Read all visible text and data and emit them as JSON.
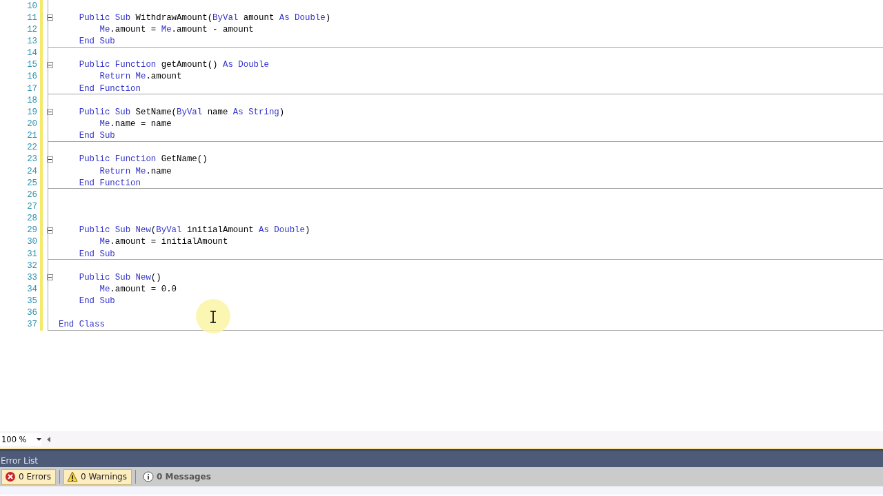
{
  "editor": {
    "lines": [
      {
        "number": "10",
        "fold": false,
        "separator_below": false
      },
      {
        "number": "11",
        "fold": true,
        "separator_below": false,
        "tokens": [
          {
            "kind": "keyword",
            "text": "    Public Sub"
          },
          {
            "kind": "plain",
            "text": " WithdrawAmount("
          },
          {
            "kind": "keyword",
            "text": "ByVal"
          },
          {
            "kind": "plain",
            "text": " amount "
          },
          {
            "kind": "keyword",
            "text": "As Double"
          },
          {
            "kind": "plain",
            "text": ")"
          }
        ]
      },
      {
        "number": "12",
        "fold": false,
        "separator_below": false,
        "tokens": [
          {
            "kind": "keyword",
            "text": "        Me"
          },
          {
            "kind": "plain",
            "text": ".amount = "
          },
          {
            "kind": "keyword",
            "text": "Me"
          },
          {
            "kind": "plain",
            "text": ".amount - amount"
          }
        ]
      },
      {
        "number": "13",
        "fold": false,
        "separator_below": true,
        "tokens": [
          {
            "kind": "keyword",
            "text": "    End Sub"
          }
        ]
      },
      {
        "number": "14",
        "fold": false,
        "separator_below": false
      },
      {
        "number": "15",
        "fold": true,
        "separator_below": false,
        "tokens": [
          {
            "kind": "keyword",
            "text": "    Public Function"
          },
          {
            "kind": "plain",
            "text": " getAmount() "
          },
          {
            "kind": "keyword",
            "text": "As Double"
          }
        ]
      },
      {
        "number": "16",
        "fold": false,
        "separator_below": false,
        "tokens": [
          {
            "kind": "keyword",
            "text": "        Return Me"
          },
          {
            "kind": "plain",
            "text": ".amount"
          }
        ]
      },
      {
        "number": "17",
        "fold": false,
        "separator_below": true,
        "tokens": [
          {
            "kind": "keyword",
            "text": "    End Function"
          }
        ]
      },
      {
        "number": "18",
        "fold": false,
        "separator_below": false
      },
      {
        "number": "19",
        "fold": true,
        "separator_below": false,
        "tokens": [
          {
            "kind": "keyword",
            "text": "    Public Sub"
          },
          {
            "kind": "plain",
            "text": " SetName("
          },
          {
            "kind": "keyword",
            "text": "ByVal"
          },
          {
            "kind": "plain",
            "text": " name "
          },
          {
            "kind": "keyword",
            "text": "As String"
          },
          {
            "kind": "plain",
            "text": ")"
          }
        ]
      },
      {
        "number": "20",
        "fold": false,
        "separator_below": false,
        "tokens": [
          {
            "kind": "keyword",
            "text": "        Me"
          },
          {
            "kind": "plain",
            "text": ".name = name"
          }
        ]
      },
      {
        "number": "21",
        "fold": false,
        "separator_below": true,
        "tokens": [
          {
            "kind": "keyword",
            "text": "    End Sub"
          }
        ]
      },
      {
        "number": "22",
        "fold": false,
        "separator_below": false
      },
      {
        "number": "23",
        "fold": true,
        "separator_below": false,
        "tokens": [
          {
            "kind": "keyword",
            "text": "    Public Function"
          },
          {
            "kind": "plain",
            "text": " GetName()"
          }
        ]
      },
      {
        "number": "24",
        "fold": false,
        "separator_below": false,
        "tokens": [
          {
            "kind": "keyword",
            "text": "        Return Me"
          },
          {
            "kind": "plain",
            "text": ".name"
          }
        ]
      },
      {
        "number": "25",
        "fold": false,
        "separator_below": true,
        "tokens": [
          {
            "kind": "keyword",
            "text": "    End Function"
          }
        ]
      },
      {
        "number": "26",
        "fold": false,
        "separator_below": false
      },
      {
        "number": "27",
        "fold": false,
        "separator_below": false
      },
      {
        "number": "28",
        "fold": false,
        "separator_below": false
      },
      {
        "number": "29",
        "fold": true,
        "separator_below": false,
        "tokens": [
          {
            "kind": "keyword",
            "text": "    Public Sub New"
          },
          {
            "kind": "plain",
            "text": "("
          },
          {
            "kind": "keyword",
            "text": "ByVal"
          },
          {
            "kind": "plain",
            "text": " initialAmount "
          },
          {
            "kind": "keyword",
            "text": "As Double"
          },
          {
            "kind": "plain",
            "text": ")"
          }
        ]
      },
      {
        "number": "30",
        "fold": false,
        "separator_below": false,
        "tokens": [
          {
            "kind": "keyword",
            "text": "        Me"
          },
          {
            "kind": "plain",
            "text": ".amount = initialAmount"
          }
        ]
      },
      {
        "number": "31",
        "fold": false,
        "separator_below": true,
        "tokens": [
          {
            "kind": "keyword",
            "text": "    End Sub"
          }
        ]
      },
      {
        "number": "32",
        "fold": false,
        "separator_below": false
      },
      {
        "number": "33",
        "fold": true,
        "separator_below": false,
        "tokens": [
          {
            "kind": "keyword",
            "text": "    Public Sub New"
          },
          {
            "kind": "plain",
            "text": "()"
          }
        ]
      },
      {
        "number": "34",
        "fold": false,
        "separator_below": false,
        "tokens": [
          {
            "kind": "keyword",
            "text": "        Me"
          },
          {
            "kind": "plain",
            "text": ".amount = 0.0"
          }
        ]
      },
      {
        "number": "35",
        "fold": false,
        "separator_below": false,
        "tokens": [
          {
            "kind": "keyword",
            "text": "    End Sub"
          }
        ]
      },
      {
        "number": "36",
        "fold": false,
        "separator_below": false
      },
      {
        "number": "37",
        "fold": false,
        "separator_below": true,
        "tokens": [
          {
            "kind": "keyword",
            "text": "End Class"
          }
        ]
      }
    ]
  },
  "zoom": {
    "value": "100 %"
  },
  "error_list": {
    "title": "Error List",
    "filters": [
      {
        "kind": "error",
        "label": "0 Errors",
        "selected": true
      },
      {
        "kind": "warning",
        "label": "0 Warnings",
        "selected": true
      },
      {
        "kind": "info",
        "label": "0 Messages",
        "selected": false
      }
    ]
  }
}
